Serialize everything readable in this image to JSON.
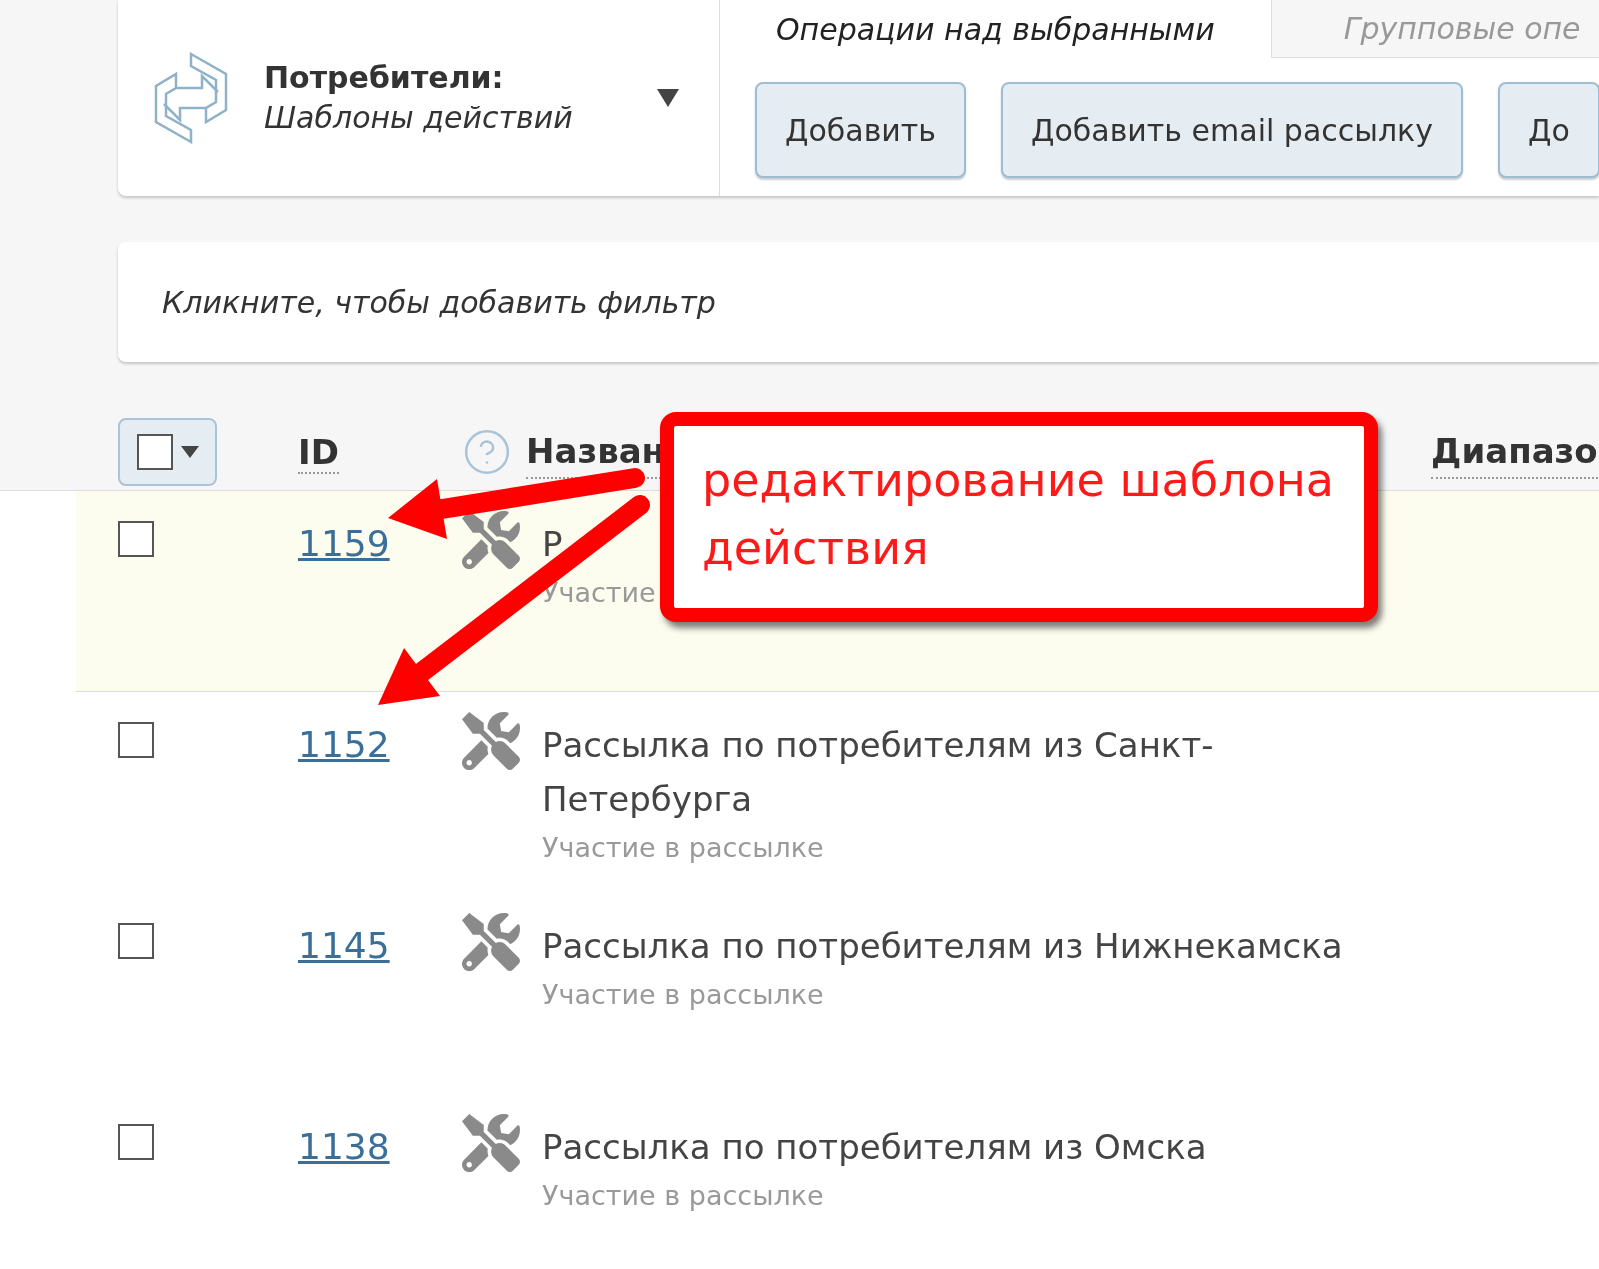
{
  "header": {
    "title": "Потребители:",
    "subtitle": "Шаблоны действий"
  },
  "tabs": [
    {
      "label": "Операции над выбранными",
      "selected": true
    },
    {
      "label": "Групповые опе",
      "selected": false
    }
  ],
  "buttons": [
    "Добавить",
    "Добавить email рассылку",
    "До"
  ],
  "filter": {
    "placeholder": "Кликните, чтобы добавить фильтр"
  },
  "table": {
    "select_all": {
      "checked": false
    },
    "columns": [
      "ID",
      "Назван",
      "Диапазо"
    ],
    "rows": [
      {
        "id": "1159",
        "name": "Р",
        "subtitle": "Участие",
        "checked": false,
        "selected": true
      },
      {
        "id": "1152",
        "name": "Рассылка по потребителям из Санкт-Петербурга",
        "subtitle": "Участие в рассылке",
        "checked": false,
        "selected": false
      },
      {
        "id": "1145",
        "name": "Рассылка по потребителям из Нижнекамска",
        "subtitle": "Участие в рассылке",
        "checked": false,
        "selected": false
      },
      {
        "id": "1138",
        "name": "Рассылка по потребителям из Омска",
        "subtitle": "Участие в рассылке",
        "checked": false,
        "selected": false
      }
    ]
  },
  "callout": {
    "text": "редактирование шаблона действия"
  }
}
